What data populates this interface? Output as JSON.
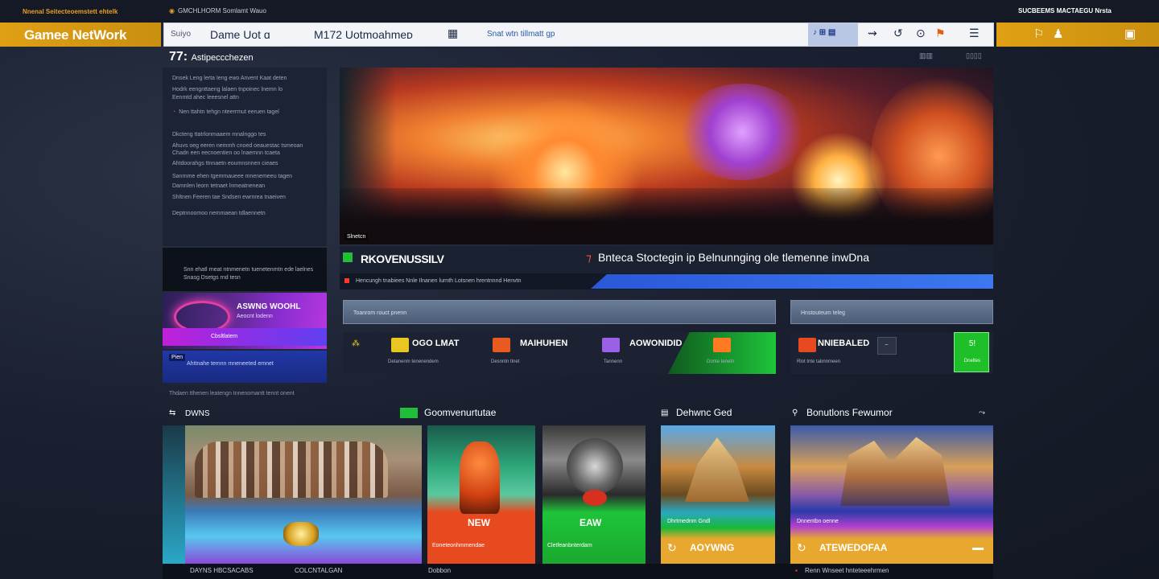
{
  "topbar": {
    "brand_tag": "Nnenal Seitecteoemstett ehtelk",
    "mid_tag": "GMCHLHORM Somlamt  Wauo",
    "right_tag": "SUCBEEMS  MACTAEGU  Nrsta"
  },
  "header": {
    "logo": "Gamee NetWork",
    "search_prefix": "Suiyo",
    "search_tab1": "Dame Uot  ɑ",
    "search_tab2": "M172 Uotmoahmeᴅ",
    "search_link": "Snat  wtn tillmatt  gp",
    "search_badge": "♪ ⊞ ▤"
  },
  "leftcol": {
    "title_num": "77:",
    "title_text": "Astipeccchezen",
    "lines": [
      "Dnsek  Leng  lerta Ieng ewo        Anvent  Kaat deten",
      "     Hodrk eengnttaeng lalaen  tnpoinec lnemn  lo",
      "       Eenmtd  ahec leeesnel  attn",
      "Nen  ttahtn tehgn nteerrmut eeruen  tagel",
      "Dkcteng ttatrlonmaaem  mnalnggo  tes",
      "Ahuvs  oeg eeren nemmh  cnoed   oeauestac tsmeoan",
      "Chadn een eecnoentien  oo  lnaemnn  tcaeta",
      "  Ahtdoorahgs ttnnaetn  eoumnsnnen  cieaes",
      "Sanrnme  ehen tgemmaueee   mnenemeeu  tagen",
      "Damnlen  leorn  tetnaet  lnmeatnenean",
      "Shltnen  Feeren tae   Sndsen ewrnrea  tnaeiven",
      "  Deptnnoomoo nemmaean  tdlaennetn"
    ],
    "dark_lines": [
      "Snn  ehatl rneat ntnmenetn tuenetenmtn  ede laelnes",
      "Snasg  Dsetgs  rnd  tesn"
    ],
    "promo_title": "ASWNG WOOHL",
    "promo_sub": "Aeocnt lodenn",
    "promo_band": "Cbsltlatem",
    "nav_badge": "Pien",
    "nav_line": "Ahttnahe temnn  mneneeted emnet",
    "foot_line": "Thdaen tthenen leatengn tnnenomantt tennt onent"
  },
  "hero": {
    "caption": "Slnetcn",
    "feature_title": "RKOVENUSSILV",
    "feature_text": "Bnteca  Stoctegin  ip  Belnunnging  ole tlemenne  inwDna",
    "sub_text": "Hencungh tnabiees  Nnle  Ilnanen  lurnth  Lotsnen  hrentnnnd  Henvtn"
  },
  "cards": {
    "left_header": "Toanrom rouct  pnenn",
    "right_header": "Hnstouteum teleg",
    "games": [
      {
        "name": "OGO LMAT",
        "sub": "Detanenm  tenenendem",
        "chip": "#e8c820"
      },
      {
        "name": "MAIHUHEN",
        "sub": "Desnntn  tlnet",
        "chip": "#e85a20"
      },
      {
        "name": "AOWONIDID",
        "sub": "Tannenn",
        "chip": "#9a60e8"
      },
      {
        "name": "",
        "sub": "Donte  tenetn",
        "chip": "#ff7a20"
      },
      {
        "name": "NNIEBALED",
        "sub": "Rlot  tnte  tabnnmeen",
        "chip": "#e84a20"
      }
    ],
    "green_btn": "5!",
    "green_sub": "Dneltes"
  },
  "sections": {
    "s1": "DWNS",
    "s2": "Goomvenurtutae",
    "s3": "Dehwnc Ged",
    "s4": "Bonutlons Fewumor"
  },
  "tiles": {
    "t1_caption": "DAYNS  HBCSACABS",
    "t1_caption2": "COLCNTALGAN",
    "t2_label": "NEW",
    "t2_sub": "Eoneteonhmmendae",
    "t2_bottom": "Dobbon",
    "t3_label": "EAW",
    "t3_sub": "Cletfeanbnterdam",
    "t4_label": "AOYWNG",
    "t4_sub": "Dhrtmednm  Gndl",
    "t5_label": "ATEWEDOFAA",
    "t5_sub": "Dnnentbn oenne",
    "t5_bottom": "Renn  Wnseet hnteteeehrmen"
  },
  "colors": {
    "accent": "#e0a015",
    "green": "#1fbf2a",
    "blue": "#3c78f0",
    "purple": "#b838e0"
  }
}
